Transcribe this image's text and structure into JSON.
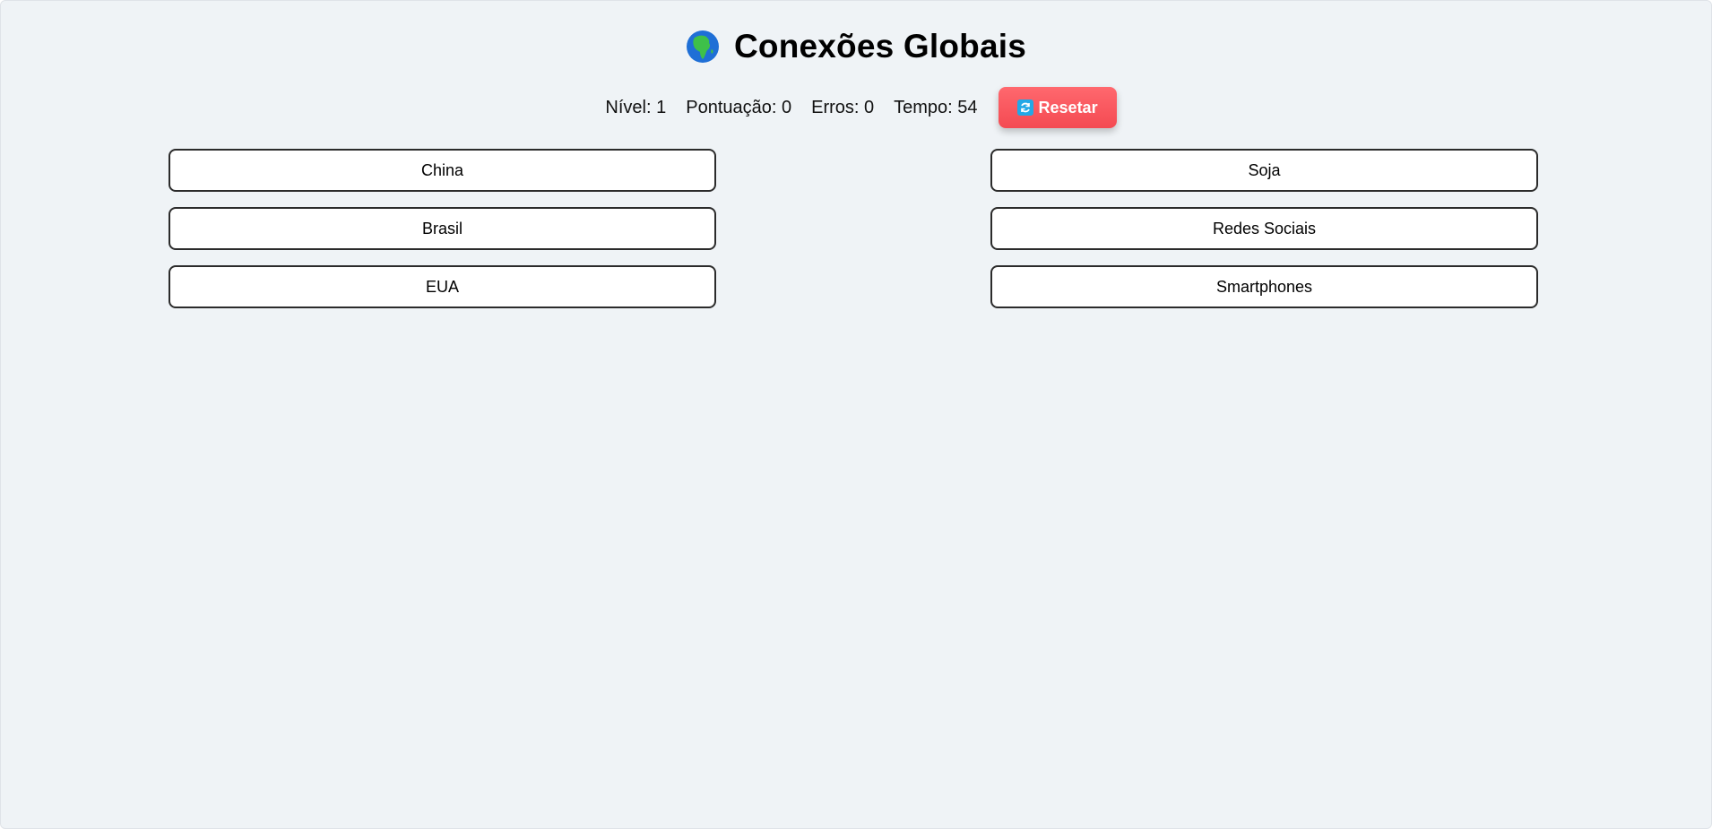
{
  "header": {
    "icon": "globe-africa-icon",
    "title": "Conexões Globais"
  },
  "stats": {
    "level": "Nível: 1",
    "score": "Pontuação: 0",
    "errors": "Erros: 0",
    "time": "Tempo: 54"
  },
  "reset_button": {
    "icon": "refresh-icon",
    "label": "Resetar",
    "color": "#f44a52"
  },
  "left_items": [
    "China",
    "Brasil",
    "EUA"
  ],
  "right_items": [
    "Soja",
    "Redes Sociais",
    "Smartphones"
  ],
  "colors": {
    "background": "#eff3f6",
    "card_border": "#2b2b2b",
    "card_background": "#ffffff"
  }
}
